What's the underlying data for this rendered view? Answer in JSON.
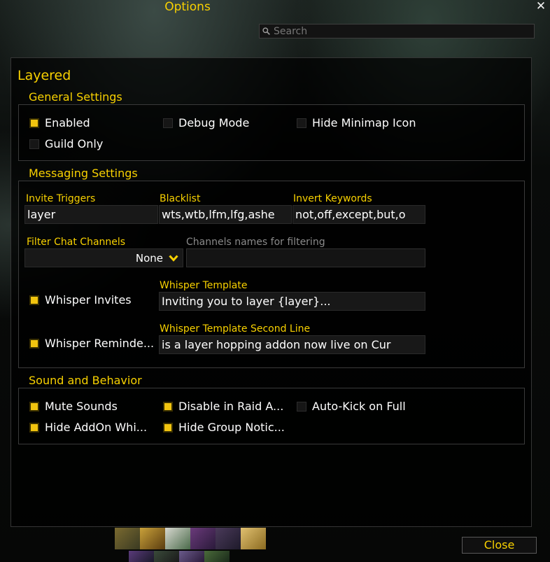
{
  "window": {
    "title": "Options",
    "close_icon": "close-x-icon"
  },
  "search": {
    "placeholder": "Search",
    "value": "",
    "icon": "search-icon"
  },
  "panel": {
    "title": "Layered"
  },
  "general": {
    "heading": "General Settings",
    "enabled": {
      "label": "Enabled",
      "checked": true
    },
    "debug_mode": {
      "label": "Debug Mode",
      "checked": false
    },
    "hide_minimap": {
      "label": "Hide Minimap Icon",
      "checked": false
    },
    "guild_only": {
      "label": "Guild Only",
      "checked": false
    }
  },
  "messaging": {
    "heading": "Messaging Settings",
    "invite_triggers": {
      "label": "Invite Triggers",
      "value": "layer"
    },
    "blacklist": {
      "label": "Blacklist",
      "value": "wts,wtb,lfm,lfg,ashe"
    },
    "invert_keywords": {
      "label": "Invert Keywords",
      "value": "not,off,except,but,o"
    },
    "filter_channels": {
      "label": "Filter Chat Channels",
      "selected": "None"
    },
    "channel_names": {
      "label": "Channels names for filtering",
      "value": ""
    },
    "whisper_invites": {
      "label": "Whisper Invites",
      "checked": true
    },
    "whisper_template": {
      "label": "Whisper Template",
      "value": "Inviting you to layer {layer}..."
    },
    "whisper_reminder": {
      "label": "Whisper Reminde...",
      "checked": true
    },
    "whisper_template_2": {
      "label": "Whisper Template Second Line",
      "value": "is a layer hopping addon now live on Cur"
    }
  },
  "sound": {
    "heading": "Sound and Behavior",
    "mute_sounds": {
      "label": "Mute Sounds",
      "checked": true
    },
    "disable_raid": {
      "label": "Disable in Raid A...",
      "checked": true
    },
    "auto_kick": {
      "label": "Auto-Kick on Full",
      "checked": false
    },
    "hide_addon": {
      "label": "Hide AddOn Whi...",
      "checked": true
    },
    "hide_group": {
      "label": "Hide Group Notic...",
      "checked": true
    }
  },
  "footer": {
    "close_label": "Close"
  },
  "colors": {
    "accent": "#f8d100",
    "checkbox_on": "#f1c40f",
    "text": "#ffffff"
  }
}
